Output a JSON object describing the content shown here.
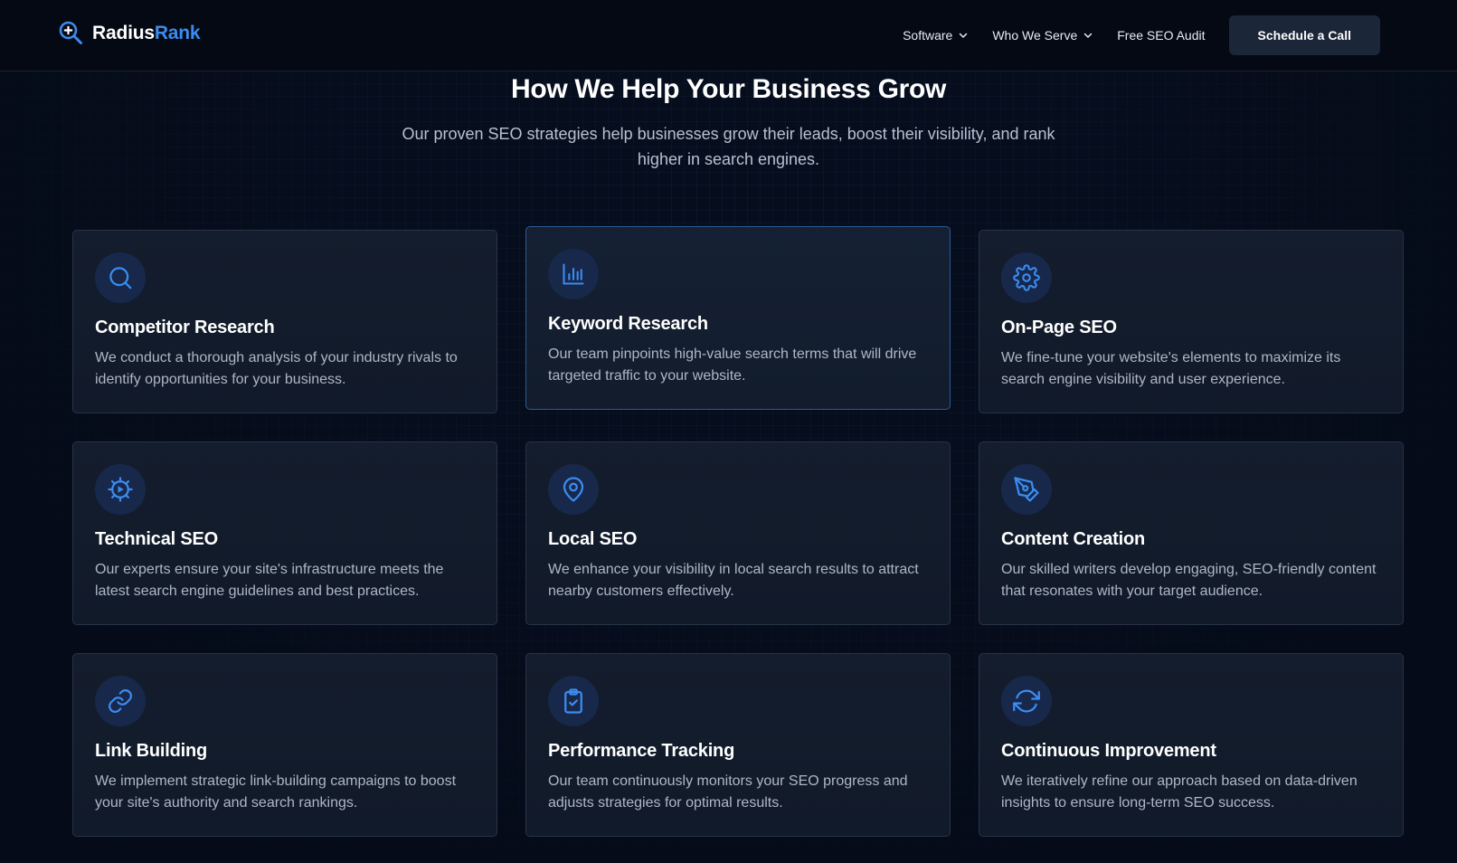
{
  "brand": {
    "name_part1": "Radius",
    "name_part2": "Rank",
    "accent": "#3b8cf0"
  },
  "nav": {
    "items": [
      {
        "label": "Software",
        "has_dropdown": true
      },
      {
        "label": "Who We Serve",
        "has_dropdown": true
      },
      {
        "label": "Free SEO Audit",
        "has_dropdown": false
      }
    ],
    "cta_label": "Schedule a Call"
  },
  "hero": {
    "title": "How We Help Your Business Grow",
    "subtitle": "Our proven SEO strategies help businesses grow their leads, boost their visibility, and rank higher in search engines."
  },
  "services": [
    {
      "icon": "search-icon",
      "title": "Competitor Research",
      "description": "We conduct a thorough analysis of your industry rivals to identify opportunities for your business."
    },
    {
      "icon": "bar-chart-icon",
      "title": "Keyword Research",
      "description": "Our team pinpoints high-value search terms that will drive targeted traffic to your website."
    },
    {
      "icon": "gear-icon",
      "title": "On-Page SEO",
      "description": "We fine-tune your website's elements to maximize its search engine visibility and user experience."
    },
    {
      "icon": "cog-play-icon",
      "title": "Technical SEO",
      "description": "Our experts ensure your site's infrastructure meets the latest search engine guidelines and best practices."
    },
    {
      "icon": "map-pin-icon",
      "title": "Local SEO",
      "description": "We enhance your visibility in local search results to attract nearby customers effectively."
    },
    {
      "icon": "pen-tool-icon",
      "title": "Content Creation",
      "description": "Our skilled writers develop engaging, SEO-friendly content that resonates with your target audience."
    },
    {
      "icon": "link-icon",
      "title": "Link Building",
      "description": "We implement strategic link-building campaigns to boost your site's authority and search rankings."
    },
    {
      "icon": "clipboard-check-icon",
      "title": "Performance Tracking",
      "description": "Our team continuously monitors your SEO progress and adjusts strategies for optimal results."
    },
    {
      "icon": "refresh-icon",
      "title": "Continuous Improvement",
      "description": "We iteratively refine our approach based on data-driven insights to ensure long-term SEO success."
    }
  ]
}
